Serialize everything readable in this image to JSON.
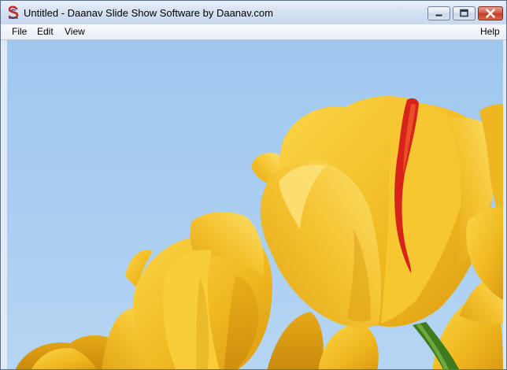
{
  "window": {
    "title": "Untitled - Daanav Slide Show Software by Daanav.com",
    "app_icon": "daanav-logo-icon"
  },
  "controls": {
    "minimize": "minimize-icon",
    "maximize": "maximize-icon",
    "close": "close-icon"
  },
  "menu": {
    "file": "File",
    "edit": "Edit",
    "view": "View",
    "help": "Help"
  },
  "slide": {
    "content": "yellow-tulips-photo"
  },
  "colors": {
    "sky": "#a9cdf0",
    "petal": "#f3c02c",
    "stripe": "#d8231a",
    "close_red": "#c13b22"
  }
}
